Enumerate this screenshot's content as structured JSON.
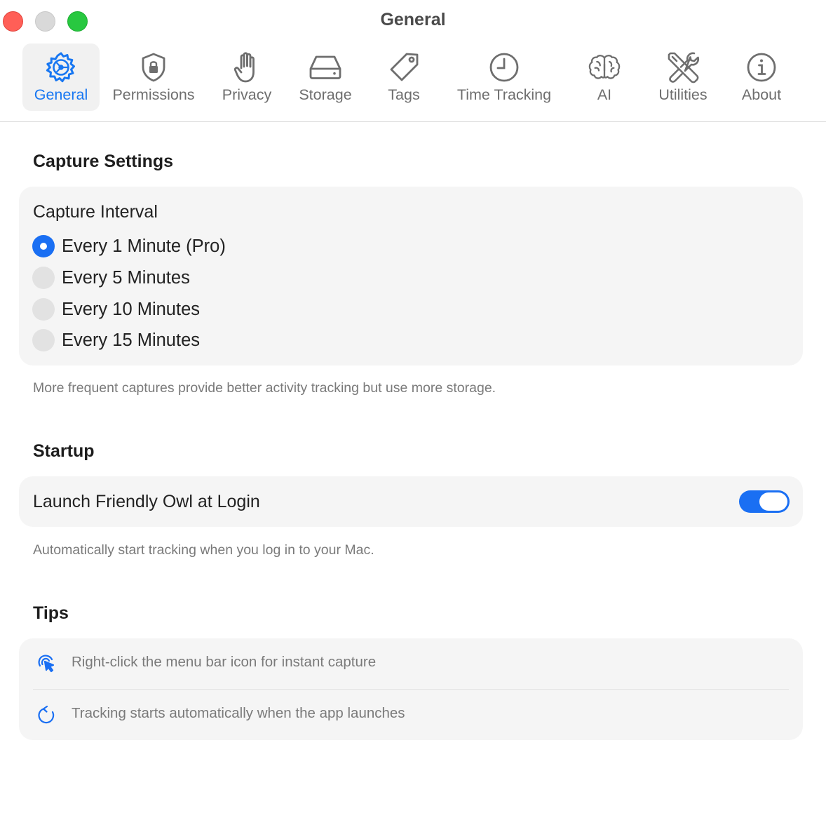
{
  "window": {
    "title": "General"
  },
  "tabs": [
    {
      "label": "General",
      "icon": "gear-icon",
      "active": true
    },
    {
      "label": "Permissions",
      "icon": "lock-shield-icon",
      "active": false
    },
    {
      "label": "Privacy",
      "icon": "hand-icon",
      "active": false
    },
    {
      "label": "Storage",
      "icon": "drive-icon",
      "active": false
    },
    {
      "label": "Tags",
      "icon": "tag-icon",
      "active": false
    },
    {
      "label": "Time Tracking",
      "icon": "clock-icon",
      "active": false
    },
    {
      "label": "AI",
      "icon": "brain-icon",
      "active": false
    },
    {
      "label": "Utilities",
      "icon": "tools-icon",
      "active": false
    },
    {
      "label": "About",
      "icon": "info-icon",
      "active": false
    }
  ],
  "capture": {
    "section_title": "Capture Settings",
    "interval_label": "Capture Interval",
    "options": [
      {
        "label": "Every 1 Minute (Pro)",
        "selected": true
      },
      {
        "label": "Every 5 Minutes",
        "selected": false
      },
      {
        "label": "Every 10 Minutes",
        "selected": false
      },
      {
        "label": "Every 15 Minutes",
        "selected": false
      }
    ],
    "hint": "More frequent captures provide better activity tracking but use more storage."
  },
  "startup": {
    "section_title": "Startup",
    "launch_label": "Launch Friendly Owl at Login",
    "launch_enabled": true,
    "hint": "Automatically start tracking when you log in to your Mac."
  },
  "tips": {
    "section_title": "Tips",
    "items": [
      {
        "icon": "cursor-click-icon",
        "text": "Right-click the menu bar icon for instant capture"
      },
      {
        "icon": "refresh-icon",
        "text": "Tracking starts automatically when the app launches"
      }
    ]
  },
  "colors": {
    "accent": "#1a6ff3",
    "active_tab": "#1877f2",
    "card_background": "#f5f5f5",
    "secondary_text": "#7a7a7a"
  }
}
